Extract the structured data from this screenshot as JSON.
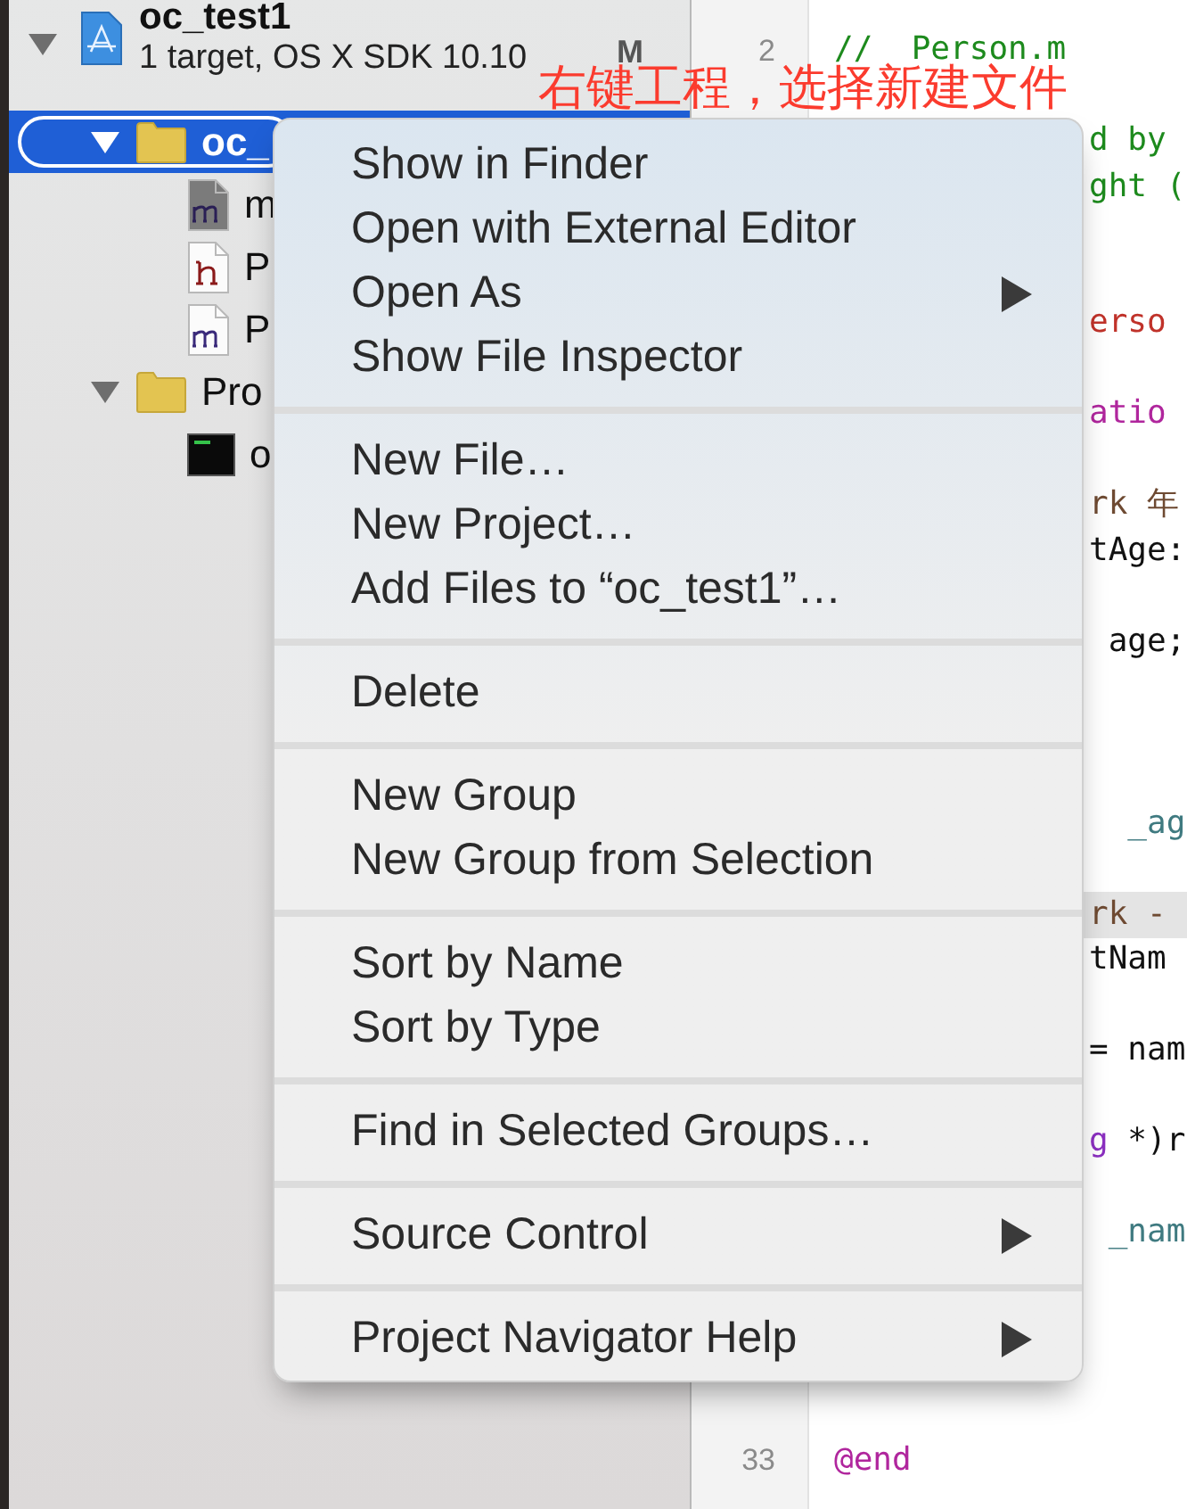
{
  "navigator": {
    "project": {
      "name": "oc_test1",
      "subtitle": "1 target, OS X SDK 10.10",
      "badge": "M",
      "expanded": true
    },
    "items": [
      {
        "label": "oc_",
        "kind": "folder",
        "expanded": true,
        "selected": true,
        "children": [
          {
            "label": "m",
            "kind": "main",
            "selected": false
          },
          {
            "label": "P",
            "kind": "header",
            "selected": false
          },
          {
            "label": "P",
            "kind": "source",
            "selected": false
          }
        ]
      },
      {
        "label": "Pro",
        "kind": "folder",
        "expanded": true,
        "selected": false,
        "children": [
          {
            "label": "o",
            "kind": "executable",
            "selected": false
          }
        ]
      }
    ]
  },
  "editor": {
    "lines": [
      {
        "kind": "empty"
      },
      {
        "kind": "full",
        "number": "2",
        "highlighted": false,
        "segments": [
          {
            "text": "//  Person.m",
            "color": "#1d8a1d"
          }
        ]
      },
      {
        "kind": "empty"
      },
      {
        "kind": "cut",
        "highlighted": false,
        "segments": [
          {
            "text": "d by",
            "color": "#1d8a1d"
          }
        ]
      },
      {
        "kind": "cut",
        "highlighted": false,
        "segments": [
          {
            "text": "ght (",
            "color": "#1d8a1d"
          }
        ]
      },
      {
        "kind": "empty"
      },
      {
        "kind": "empty"
      },
      {
        "kind": "cut",
        "highlighted": false,
        "segments": [
          {
            "text": "erso",
            "color": "#c0322a"
          }
        ]
      },
      {
        "kind": "empty"
      },
      {
        "kind": "cut",
        "highlighted": false,
        "segments": [
          {
            "text": "atio",
            "color": "#b0269d"
          }
        ]
      },
      {
        "kind": "empty"
      },
      {
        "kind": "cut",
        "highlighted": false,
        "segments": [
          {
            "text": "rk 年",
            "color": "#6e4a32"
          }
        ]
      },
      {
        "kind": "cut",
        "highlighted": false,
        "segments": [
          {
            "text": "tAge:",
            "color": "#111111"
          }
        ]
      },
      {
        "kind": "empty"
      },
      {
        "kind": "cut",
        "highlighted": false,
        "segments": [
          {
            "text": " age;",
            "color": "#111111"
          }
        ]
      },
      {
        "kind": "empty"
      },
      {
        "kind": "empty"
      },
      {
        "kind": "empty"
      },
      {
        "kind": "cut",
        "highlighted": false,
        "segments": [
          {
            "text": "  _ag",
            "color": "#3f7a80"
          }
        ]
      },
      {
        "kind": "empty"
      },
      {
        "kind": "cut",
        "highlighted": true,
        "segments": [
          {
            "text": "rk -",
            "color": "#6e4a32"
          }
        ]
      },
      {
        "kind": "cut",
        "highlighted": false,
        "segments": [
          {
            "text": "tNam",
            "color": "#111111"
          }
        ]
      },
      {
        "kind": "empty"
      },
      {
        "kind": "cut",
        "highlighted": false,
        "segments": [
          {
            "text": "= nam",
            "color": "#111111"
          }
        ]
      },
      {
        "kind": "empty"
      },
      {
        "kind": "cut",
        "highlighted": false,
        "segments": [
          {
            "text": "g",
            "color": "#8b2fc0"
          },
          {
            "text": " *)r",
            "color": "#111111"
          }
        ]
      },
      {
        "kind": "empty"
      },
      {
        "kind": "cut",
        "highlighted": false,
        "segments": [
          {
            "text": " _nam",
            "color": "#3f7a80"
          }
        ]
      },
      {
        "kind": "empty"
      },
      {
        "kind": "empty"
      },
      {
        "kind": "empty"
      },
      {
        "kind": "empty"
      },
      {
        "kind": "full",
        "number": "33",
        "highlighted": false,
        "segments": [
          {
            "text": "@end",
            "color": "#b0269d"
          }
        ]
      }
    ]
  },
  "context_menu": {
    "sections": [
      [
        {
          "label": "Show in Finder",
          "submenu": false
        },
        {
          "label": "Open with External Editor",
          "submenu": false
        },
        {
          "label": "Open As",
          "submenu": true
        },
        {
          "label": "Show File Inspector",
          "submenu": false
        }
      ],
      [
        {
          "label": "New File…",
          "submenu": false
        },
        {
          "label": "New Project…",
          "submenu": false
        },
        {
          "label": "Add Files to “oc_test1”…",
          "submenu": false
        }
      ],
      [
        {
          "label": "Delete",
          "submenu": false
        }
      ],
      [
        {
          "label": "New Group",
          "submenu": false
        },
        {
          "label": "New Group from Selection",
          "submenu": false
        }
      ],
      [
        {
          "label": "Sort by Name",
          "submenu": false
        },
        {
          "label": "Sort by Type",
          "submenu": false
        }
      ],
      [
        {
          "label": "Find in Selected Groups…",
          "submenu": false
        }
      ],
      [
        {
          "label": "Source Control",
          "submenu": true
        }
      ],
      [
        {
          "label": "Project Navigator Help",
          "submenu": true
        }
      ]
    ]
  },
  "annotation": "右键工程，选择新建文件"
}
